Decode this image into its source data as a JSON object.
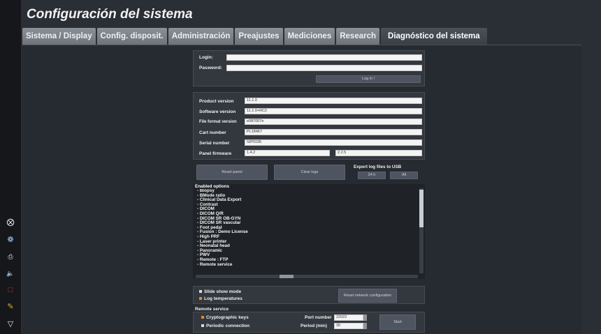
{
  "title": "Configuración del sistema",
  "tabs": [
    "Sistema / Display",
    "Config. disposit.",
    "Administración",
    "Preajustes",
    "Mediciones",
    "Research",
    "Diagnóstico del sistema"
  ],
  "login": {
    "login_label": "Login:",
    "password_label": "Password:",
    "login_button": "Log in !"
  },
  "versions": [
    {
      "label": "Product version",
      "value": "11.1.0"
    },
    {
      "label": "Software version",
      "value": "11.1.0+RC2"
    },
    {
      "label": "File format version",
      "value": "e087007e"
    },
    {
      "label": "Cart number",
      "value": "PL18467"
    },
    {
      "label": "Serial number",
      "value": "SIP0195"
    },
    {
      "label": "Panel firmware",
      "value": "1.4.2",
      "value2": "2.2.5"
    }
  ],
  "actions": {
    "reset_panel": "Reset panel",
    "clear_logs": "Clear logs",
    "export_title": "Export log files to USB",
    "export_24h": "24 h",
    "export_all": "All"
  },
  "enabled_options": {
    "title": "Enabled options",
    "items": [
      "- Biopsy",
      "- BMode ratio",
      "- Clinical Data Export",
      "- Contrast",
      "- DICOM",
      "- DICOM Q/R",
      "- DICOM SR OB-GYN",
      "- DICOM SR vascular",
      "- Foot pedal",
      "- Fusion : Demo License",
      "- High PRF",
      "- Laser printer",
      "- Neonatal head",
      "- Panoramic",
      "- PWV",
      "- Remote : FTP",
      "- Remote service"
    ]
  },
  "settings": {
    "slide_show": "Slide show mode",
    "log_temps": "Log temperatures",
    "reset_network": "Reset network configuration"
  },
  "remote": {
    "title": "Remote service",
    "crypto": "Cryptographic keys",
    "periodic": "Periodic connection",
    "port_label": "Port number",
    "port_value": "22022",
    "period_label": "Period (min)",
    "period_value": "30",
    "start": "Start"
  },
  "colors": {
    "accent_orange": "#e08a2a",
    "tab": "#7c8088"
  },
  "side_icons": [
    "close-circle-icon",
    "network-icon",
    "printer-icon",
    "speaker-icon",
    "export-icon",
    "broom-icon",
    "wifi-icon"
  ]
}
